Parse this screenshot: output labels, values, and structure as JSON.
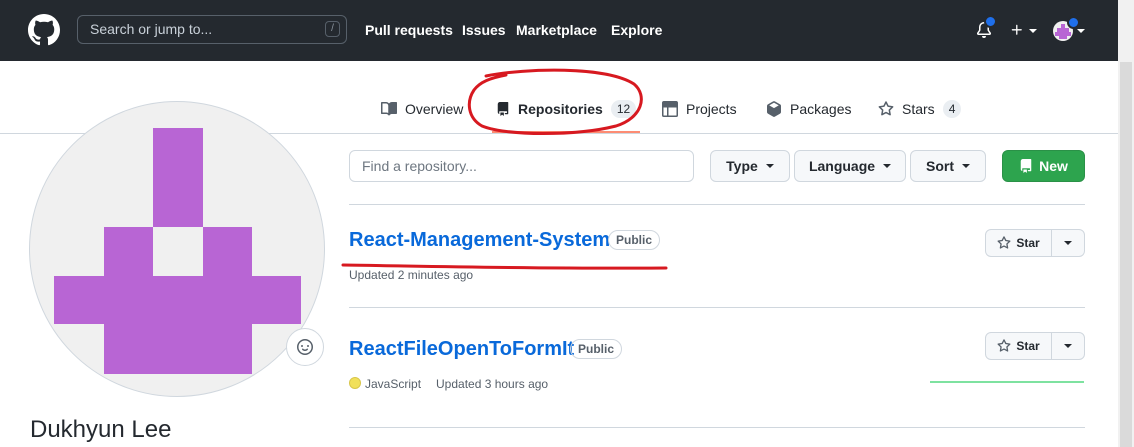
{
  "header": {
    "search_placeholder": "Search or jump to...",
    "search_shortcut": "/",
    "nav": [
      "Pull requests",
      "Issues",
      "Marketplace",
      "Explore"
    ],
    "icons": [
      "github-logo-icon",
      "bell-icon",
      "plus-icon",
      "avatar-icon"
    ]
  },
  "tabs": [
    {
      "label": "Overview",
      "icon": "book-icon"
    },
    {
      "label": "Repositories",
      "icon": "repo-icon",
      "count": "12",
      "active": true
    },
    {
      "label": "Projects",
      "icon": "table-icon"
    },
    {
      "label": "Packages",
      "icon": "package-icon"
    },
    {
      "label": "Stars",
      "icon": "star-icon",
      "count": "4"
    }
  ],
  "profile": {
    "name": "Dukhyun Lee",
    "avatar_color": "#b865d4"
  },
  "filters": {
    "find_placeholder": "Find a repository...",
    "type_label": "Type",
    "language_label": "Language",
    "sort_label": "Sort",
    "new_label": "New"
  },
  "repos": [
    {
      "name": "React-Management-System",
      "visibility": "Public",
      "updated": "Updated 2 minutes ago",
      "star_label": "Star"
    },
    {
      "name": "ReactFileOpenToFormIt",
      "visibility": "Public",
      "language": "JavaScript",
      "language_color": "#f1e05a",
      "updated": "Updated 3 hours ago",
      "star_label": "Star"
    }
  ],
  "colors": {
    "header_bg": "#24292f",
    "link": "#0969da",
    "primary_button": "#2da44e",
    "annotation": "#d71920"
  }
}
